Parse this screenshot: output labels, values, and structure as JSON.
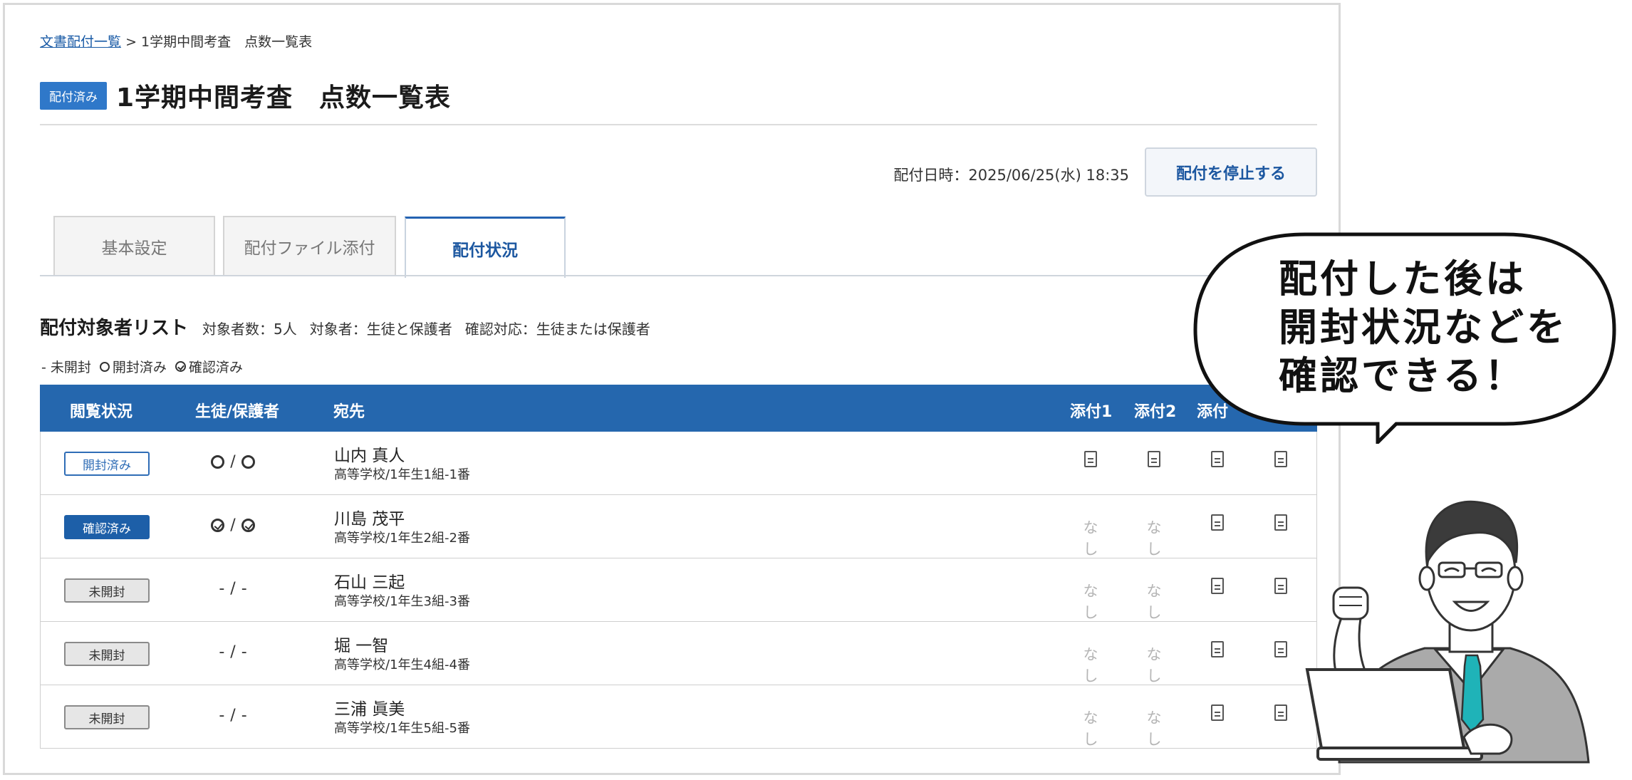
{
  "breadcrumb": {
    "link": "文書配付一覧",
    "separator": ">",
    "current": "1学期中間考査　点数一覧表"
  },
  "header": {
    "status_tag": "配付済み",
    "title": "1学期中間考査　点数一覧表"
  },
  "distribution": {
    "date_text": "配付日時：2025/06/25(水) 18:35",
    "stop_button": "配付を停止する"
  },
  "tabs": [
    {
      "label": "基本設定",
      "active": false
    },
    {
      "label": "配付ファイル添付",
      "active": false
    },
    {
      "label": "配付状況",
      "active": true
    }
  ],
  "recipient_list": {
    "heading": "配付対象者リスト",
    "count": "対象者数：5人",
    "targets": "対象者：生徒と保護者",
    "confirm": "確認対応：生徒または保護者"
  },
  "legend": {
    "unopened": "- 未開封",
    "opened": "開封済み",
    "confirmed": "確認済み"
  },
  "table": {
    "columns": [
      "閲覧状況",
      "生徒/保護者",
      "宛先",
      "添付1",
      "添付2",
      "添付"
    ],
    "rows": [
      {
        "status": "開封済み",
        "status_type": "opened",
        "student": "opened",
        "guardian": "opened",
        "name": "山内 真人",
        "school": "高等学校/1年生1組-1番",
        "att1": "file",
        "att2": "file",
        "att3": "file",
        "att4": "file"
      },
      {
        "status": "確認済み",
        "status_type": "confirmed",
        "student": "confirmed",
        "guardian": "confirmed",
        "name": "川島 茂平",
        "school": "高等学校/1年生2組-2番",
        "att1": "なし",
        "att2": "なし",
        "att3": "file",
        "att4": "file"
      },
      {
        "status": "未開封",
        "status_type": "unopened",
        "student": "-",
        "guardian": "-",
        "name": "石山 三起",
        "school": "高等学校/1年生3組-3番",
        "att1": "なし",
        "att2": "なし",
        "att3": "file",
        "att4": "file"
      },
      {
        "status": "未開封",
        "status_type": "unopened",
        "student": "-",
        "guardian": "-",
        "name": "堀 一智",
        "school": "高等学校/1年生4組-4番",
        "att1": "なし",
        "att2": "なし",
        "att3": "file",
        "att4": "file"
      },
      {
        "status": "未開封",
        "status_type": "unopened",
        "student": "-",
        "guardian": "-",
        "name": "三浦 眞美",
        "school": "高等学校/1年生5組-5番",
        "att1": "なし",
        "att2": "なし",
        "att3": "file",
        "att4": "file"
      }
    ]
  },
  "speech_bubble": {
    "lines": [
      "配付した後は",
      "開封状況などを",
      "確認できる！"
    ]
  },
  "colors": {
    "primary": "#2567ae",
    "tag": "#2f78c9",
    "tie": "#1fb3b8",
    "suit": "#a9a9a9"
  },
  "icons": {
    "attachment": "document-icon",
    "opened": "circle-icon",
    "confirmed": "check-circle-icon"
  }
}
